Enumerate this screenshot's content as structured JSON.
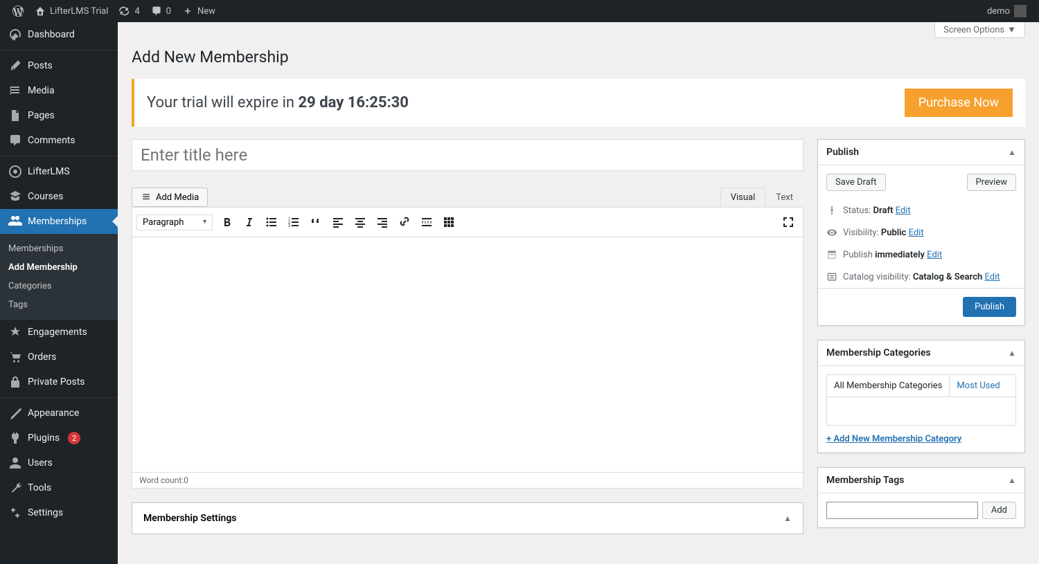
{
  "adminbar": {
    "site_title": "LifterLMS Trial",
    "updates": "4",
    "comments": "0",
    "new": "New",
    "user": "demo"
  },
  "sidebar": {
    "dashboard": "Dashboard",
    "posts": "Posts",
    "media": "Media",
    "pages": "Pages",
    "comments": "Comments",
    "lifterlms": "LifterLMS",
    "courses": "Courses",
    "memberships": "Memberships",
    "submenu": {
      "memberships": "Memberships",
      "add": "Add Membership",
      "categories": "Categories",
      "tags": "Tags"
    },
    "engagements": "Engagements",
    "orders": "Orders",
    "private_posts": "Private Posts",
    "appearance": "Appearance",
    "plugins": "Plugins",
    "plugins_badge": "2",
    "users": "Users",
    "tools": "Tools",
    "settings": "Settings"
  },
  "screen_options": "Screen Options",
  "page_title": "Add New Membership",
  "trial": {
    "prefix": "Your trial will expire in ",
    "countdown": "29 day 16:25:30",
    "purchase": "Purchase Now"
  },
  "title_placeholder": "Enter title here",
  "editor": {
    "add_media": "Add Media",
    "visual": "Visual",
    "text": "Text",
    "paragraph": "Paragraph",
    "wordcount_label": "Word count: ",
    "wordcount": "0"
  },
  "settings_box": "Membership Settings",
  "publish": {
    "title": "Publish",
    "save_draft": "Save Draft",
    "preview": "Preview",
    "status_label": "Status: ",
    "status_value": "Draft",
    "visibility_label": "Visibility: ",
    "visibility_value": "Public",
    "publish_label": "Publish ",
    "publish_value": "immediately",
    "catalog_label": "Catalog visibility: ",
    "catalog_value": "Catalog & Search",
    "edit": "Edit",
    "publish_btn": "Publish"
  },
  "categories": {
    "title": "Membership Categories",
    "tab_all": "All Membership Categories",
    "tab_used": "Most Used",
    "add_new": "+ Add New Membership Category"
  },
  "tags": {
    "title": "Membership Tags",
    "add": "Add"
  }
}
